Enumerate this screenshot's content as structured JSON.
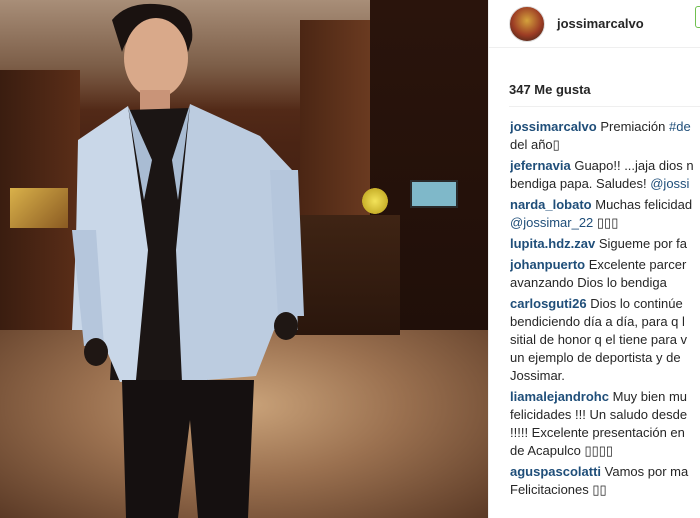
{
  "post": {
    "username": "jossimarcalvo",
    "likes": "347 Me gusta",
    "comments": [
      {
        "user": "jossimarcalvo",
        "lines": [
          [
            "Premiación ",
            "#de"
          ],
          [
            "del año▯"
          ]
        ]
      },
      {
        "user": "jefernavia",
        "lines": [
          [
            "Guapo!! ...jaja dios n"
          ],
          [
            "bendiga papa. Saludes! ",
            "@jossi"
          ]
        ]
      },
      {
        "user": "narda_lobato",
        "lines": [
          [
            "Muchas felicidad"
          ],
          [
            "",
            "@jossimar_22",
            " ▯▯▯"
          ]
        ]
      },
      {
        "user": "lupita.hdz.zav",
        "lines": [
          [
            "Sigueme por fa"
          ]
        ]
      },
      {
        "user": "johanpuerto",
        "lines": [
          [
            "Excelente parcer"
          ],
          [
            "avanzando Dios lo bendiga"
          ]
        ]
      },
      {
        "user": "carlosguti26",
        "lines": [
          [
            "Dios lo continúe"
          ],
          [
            "bendiciendo día a día, para q l"
          ],
          [
            "sitial de honor q el tiene para v"
          ],
          [
            "un ejemplo de deportista y de"
          ],
          [
            "Jossimar."
          ]
        ]
      },
      {
        "user": "liamalejandrohc",
        "lines": [
          [
            "Muy bien mu"
          ],
          [
            "felicidades !!! Un saludo desde"
          ],
          [
            "!!!!! Excelente presentación en"
          ],
          [
            "de Acapulco ▯▯▯▯"
          ]
        ]
      },
      {
        "user": "aguspascolatti",
        "lines": [
          [
            "Vamos por ma"
          ],
          [
            "Felicitaciones ▯▯"
          ]
        ]
      }
    ]
  }
}
